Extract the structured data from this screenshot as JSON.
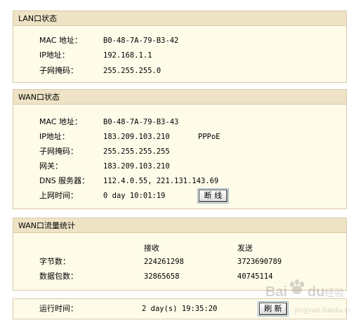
{
  "lan": {
    "title": "LAN口状态",
    "rows": [
      {
        "label": "MAC 地址：",
        "value": "B0-48-7A-79-B3-42"
      },
      {
        "label": "IP地址：",
        "value": "192.168.1.1"
      },
      {
        "label": "子网掩码：",
        "value": "255.255.255.0"
      }
    ]
  },
  "wan": {
    "title": "WAN口状态",
    "rows": [
      {
        "label": "MAC 地址：",
        "value": "B0-48-7A-79-B3-43",
        "extra": ""
      },
      {
        "label": "IP地址：",
        "value": "183.209.103.210",
        "extra": "PPPoE"
      },
      {
        "label": "子网掩码：",
        "value": "255.255.255.255",
        "extra": ""
      },
      {
        "label": "网关：",
        "value": "183.209.103.210",
        "extra": ""
      },
      {
        "label": "DNS 服务器：",
        "value": "112.4.0.55, 221.131.143.69",
        "extra": ""
      },
      {
        "label": "上网时间：",
        "value": "0 day 10:01:19",
        "extra": ""
      }
    ],
    "disconnect_label": "断 线"
  },
  "stats": {
    "title": "WAN口流量统计",
    "col_recv": "接收",
    "col_send": "发送",
    "rows": [
      {
        "label": "字节数：",
        "recv": "224261298",
        "send": "3723690789"
      },
      {
        "label": "数据包数：",
        "recv": "32865658",
        "send": "40745114"
      }
    ]
  },
  "runtime": {
    "label": "运行时间：",
    "value": "2 day(s) 19:35:20",
    "refresh_label": "刷 新"
  },
  "watermark": {
    "text": "Baidu 经验",
    "url": "jingyan.baidu.com"
  }
}
